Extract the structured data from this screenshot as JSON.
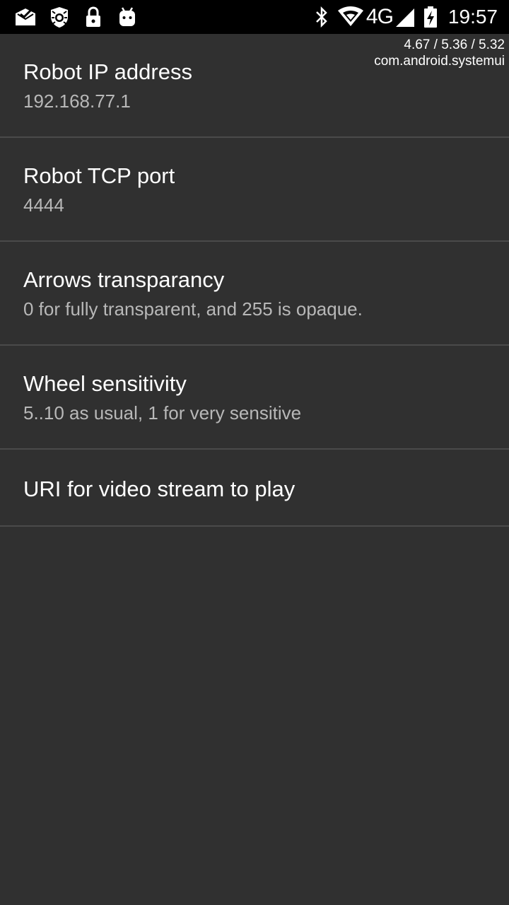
{
  "status_bar": {
    "network_type": "4G",
    "time": "19:57",
    "left_icons": [
      "mail-check-icon",
      "shield-bug-icon",
      "lock-icon",
      "android-icon"
    ],
    "right_icons": [
      "bluetooth-icon",
      "wifi-icon",
      "cellular-signal-icon",
      "battery-charging-icon"
    ]
  },
  "overlay": {
    "load_average": "4.67 / 5.36 / 5.32",
    "process_name": "com.android.systemui"
  },
  "preferences": [
    {
      "title": "Robot IP address",
      "summary": "192.168.77.1"
    },
    {
      "title": "Robot TCP port",
      "summary": "4444"
    },
    {
      "title": "Arrows transparancy",
      "summary": "0 for fully transparent, and 255 is opaque."
    },
    {
      "title": "Wheel sensitivity",
      "summary": "5..10 as usual, 1 for very sensitive"
    },
    {
      "title": "URI for video stream to play",
      "summary": ""
    }
  ],
  "colors": {
    "background": "#303030",
    "status_bar": "#000000",
    "title_text": "#ffffff",
    "summary_text": "#b8b8b8",
    "divider": "#4a4a4a"
  }
}
